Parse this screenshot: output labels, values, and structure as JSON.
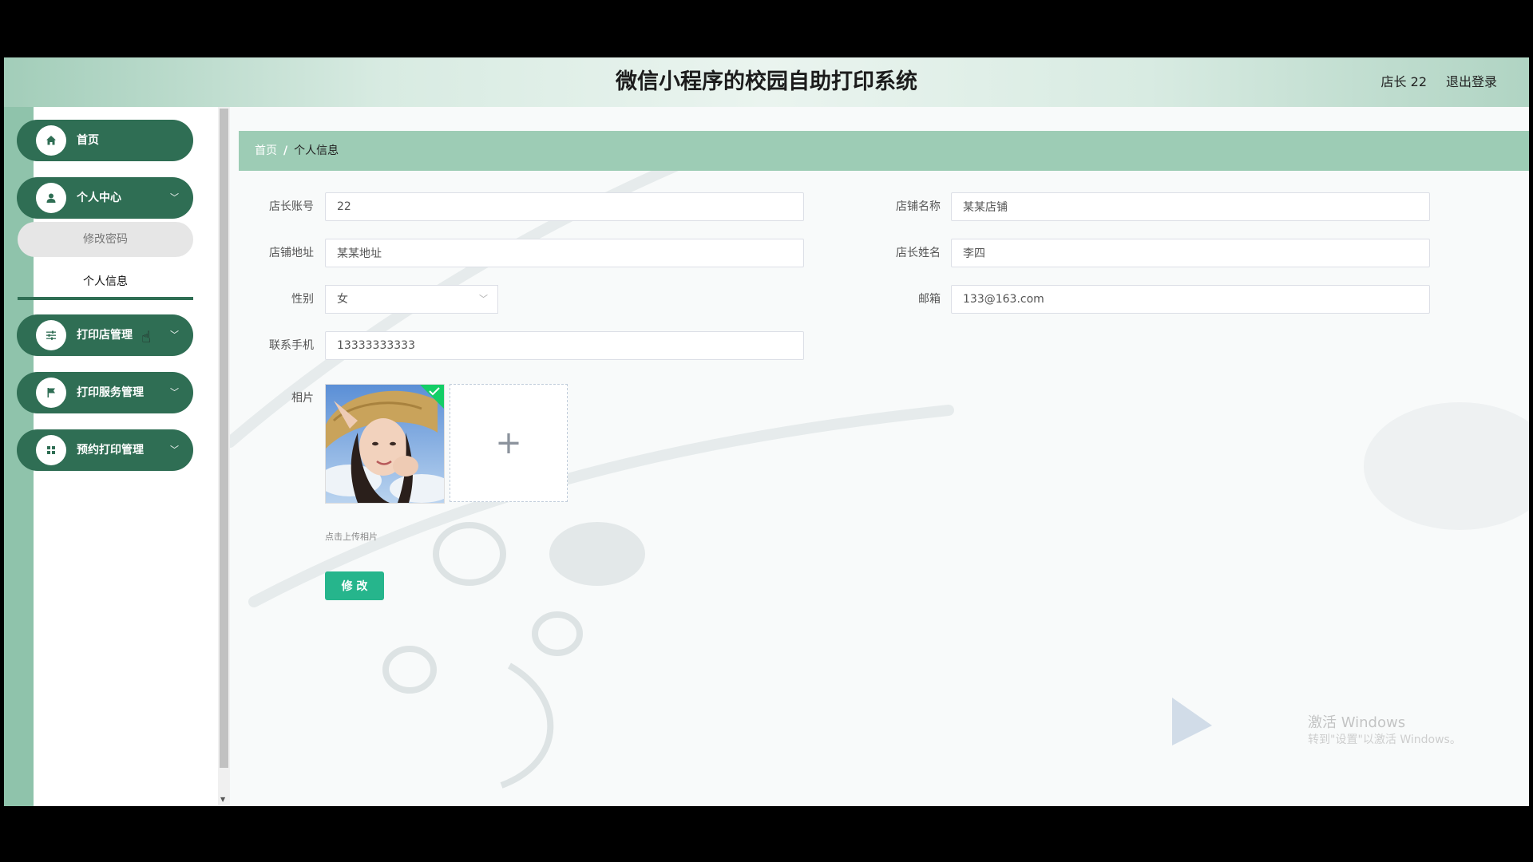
{
  "header": {
    "title": "微信小程序的校园自助打印系统",
    "user": "店长 22",
    "logout": "退出登录"
  },
  "sidebar": {
    "items": [
      {
        "label": "首页",
        "icon": "home-icon"
      },
      {
        "label": "个人中心",
        "icon": "user-icon"
      },
      {
        "label": "打印店管理",
        "icon": "sliders-icon"
      },
      {
        "label": "打印服务管理",
        "icon": "flag-icon"
      },
      {
        "label": "预约打印管理",
        "icon": "grid-icon"
      }
    ],
    "sub_items": [
      {
        "label": "修改密码"
      },
      {
        "label": "个人信息"
      }
    ]
  },
  "breadcrumb": {
    "home": "首页",
    "separator": "/",
    "current": "个人信息"
  },
  "form": {
    "account_label": "店长账号",
    "account_value": "22",
    "shop_name_label": "店铺名称",
    "shop_name_value": "某某店铺",
    "address_label": "店铺地址",
    "address_value": "某某地址",
    "manager_name_label": "店长姓名",
    "manager_name_value": "李四",
    "gender_label": "性别",
    "gender_value": "女",
    "email_label": "邮箱",
    "email_value": "133@163.com",
    "phone_label": "联系手机",
    "phone_value": "13333333333",
    "photo_label": "相片",
    "upload_plus": "+",
    "upload_hint": "点击上传相片",
    "submit_label": "修 改"
  },
  "watermark": {
    "line1": "激活 Windows",
    "line2": "转到\"设置\"以激活 Windows。"
  },
  "colors": {
    "sidebar_pill": "#2f6e54",
    "breadcrumb_bg": "#9dccb5",
    "button": "#26b58c"
  }
}
